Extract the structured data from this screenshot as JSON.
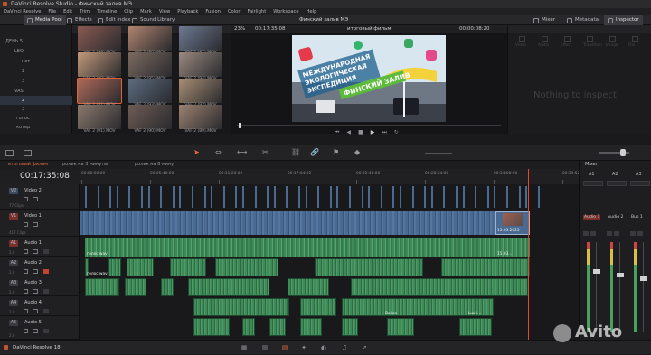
{
  "titlebar": {
    "app": "DaVinci Resolve Studio - Финский залив МЭ"
  },
  "menu": [
    "DaVinci Resolve",
    "File",
    "Edit",
    "Trim",
    "Timeline",
    "Clip",
    "Mark",
    "View",
    "Playback",
    "Fusion",
    "Color",
    "Fairlight",
    "Workspace",
    "Help"
  ],
  "toolbar": {
    "media_pool": "Media Pool",
    "effects": "Effects",
    "edit_index": "Edit Index",
    "sound_library": "Sound Library",
    "project_title": "Финский залив МЭ",
    "mixer": "Mixer",
    "metadata": "Metadata",
    "inspector": "Inspector"
  },
  "media_pool": {
    "bin_counter": "2",
    "tree": [
      "ДЕНЬ 5",
      "LEO",
      "нет",
      "2",
      "3",
      "VAS",
      "2",
      "3",
      "голос",
      "котер",
      "титры"
    ],
    "selected_index": 6,
    "clips": [
      "VAF 2 (99).MOV",
      "VAF 2 (80).MOV",
      "VAF 2 (87).MOV",
      "VAF 2 (98).MOV",
      "VAF 2 (95).MOV",
      "VAF 2 (94).MOV",
      "VAF 2 (81).MOV",
      "VAF 2 (93).MOV",
      "VAF 2 (92).MOV",
      "VAF 2 (91).MOV",
      "VAF 2 (90).MOV",
      "VAF 2 (89).MOV"
    ],
    "selected_clip": 6
  },
  "viewer": {
    "zoom": "23%",
    "source_tc": "00:17:35:08",
    "timeline_name": "итоговый фильм",
    "duration_tc": "00:00:08:20",
    "title_lines": [
      "МЕЖДУНАРОДНАЯ",
      "ЭКОЛОГИЧЕСКАЯ",
      "ЭКСПЕДИЦИЯ"
    ],
    "title_banner": "ФИНСКИЙ ЗАЛИВ"
  },
  "inspector": {
    "empty_text": "Nothing to inspect",
    "tabs": [
      "Video",
      "Audio",
      "Effect",
      "Transition",
      "Image",
      "File"
    ]
  },
  "timeline": {
    "tabs": [
      "итоговый фильм",
      "ролик на 3 минуты",
      "ролик на 8 минут"
    ],
    "selected_tab": 0,
    "timecode": "00:17:35:08",
    "ruler": [
      "00:00:00:00",
      "00:05:40:00",
      "00:11:20:00",
      "00:17:04:02",
      "00:22:48:00",
      "00:28:24:00",
      "00:34:08:00",
      "00:39:52:02",
      "00:45:36:00"
    ],
    "tracks": [
      {
        "id": "V2",
        "name": "Video 2",
        "meta": "77 Clips",
        "color": "#3a4a60"
      },
      {
        "id": "V1",
        "name": "Video 1",
        "meta": "417 Clips",
        "color": "#7a2f2a"
      },
      {
        "id": "A1",
        "name": "Audio 1",
        "meta": "2.0",
        "color": "#7a2f2a"
      },
      {
        "id": "A2",
        "name": "Audio 2",
        "meta": "2.0",
        "color": "#3a3a40"
      },
      {
        "id": "A3",
        "name": "Audio 3",
        "meta": "2.0",
        "color": "#3a3a40"
      },
      {
        "id": "A4",
        "name": "Audio 4",
        "meta": "2.0",
        "color": "#3a3a40"
      },
      {
        "id": "A5",
        "name": "Audio 5",
        "meta": "2.0",
        "color": "#3a3a40"
      }
    ],
    "clip_labels": {
      "v1_end": "15.03.2025",
      "a1_end": "15.03...",
      "a1_start": "голос.wav",
      "a2_start": "голос.wav",
      "a4_1": "Balloo",
      "a4_2": "Lux i..."
    }
  },
  "mixer": {
    "title": "Mixer",
    "channels": [
      "Audio 1",
      "Audio 2",
      "Bus 1"
    ],
    "channel_ids": [
      "A1",
      "A2",
      "Bus 1"
    ],
    "columns": [
      "A1",
      "A2",
      "A3"
    ]
  },
  "footer": {
    "version": "DaVinci Resolve 18",
    "watermark": "Avito"
  },
  "colors": {
    "accent": "#e66a3c",
    "video_clip": "#4a6a92",
    "audio_clip": "#3f8a58",
    "playhead": "#e24a2e"
  }
}
